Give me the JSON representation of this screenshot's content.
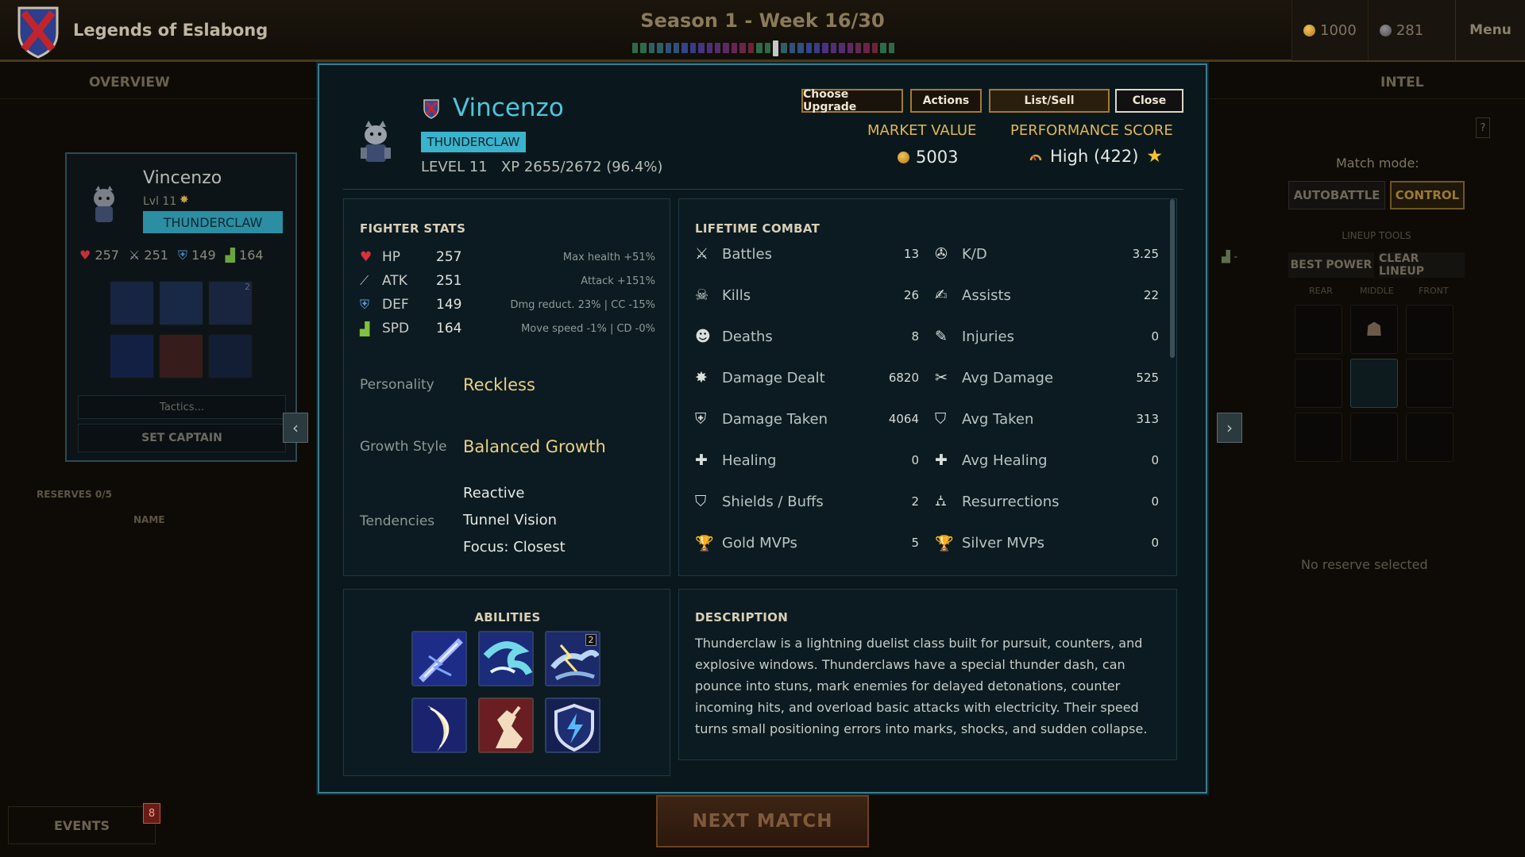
{
  "header": {
    "game_title": "Legends of Eslabong",
    "season": "Season 1 - Week 16/30",
    "week_current": 16,
    "week_total": 30,
    "gold": "1000",
    "gems": "281",
    "menu_label": "Menu"
  },
  "tabs": {
    "overview": "OVERVIEW",
    "intel": "INTEL"
  },
  "background_card": {
    "name": "Vincenzo",
    "level": "Lvl 11",
    "class": "THUNDERCLAW",
    "hp": "257",
    "atk": "251",
    "def": "149",
    "spd": "164",
    "ability_badge": "2",
    "tactics_label": "Tactics...",
    "set_captain_label": "SET CAPTAIN",
    "reserves_label": "RESERVES",
    "reserves_count": "0/5",
    "name_header": "NAME"
  },
  "right_panel": {
    "help": "?",
    "match_mode_label": "Match mode:",
    "autobattle": "AUTOBATTLE",
    "control": "CONTROL",
    "lineup_tools": "LINEUP TOOLS",
    "best_power": "BEST POWER",
    "clear_lineup": "CLEAR LINEUP",
    "rear": "REAR",
    "middle": "MIDDLE",
    "front": "FRONT",
    "no_reserve": "No reserve selected",
    "spd_dash": "-"
  },
  "footer": {
    "events_label": "EVENTS",
    "events_badge": "8",
    "next_match": "NEXT MATCH"
  },
  "fighter": {
    "name": "Vincenzo",
    "class": "THUNDERCLAW",
    "level_label": "LEVEL 11",
    "xp_label": "XP 2655/2672 (96.4%)",
    "market_value_label": "MARKET VALUE",
    "market_value": "5003",
    "performance_label": "PERFORMANCE SCORE",
    "performance_value": "High (422)"
  },
  "actions": {
    "choose_upgrade": "Choose Upgrade",
    "actions": "Actions",
    "list_sell": "List/Sell",
    "close": "Close"
  },
  "stats": {
    "title": "FIGHTER STATS",
    "rows": [
      {
        "label": "HP",
        "value": "257",
        "note": "Max health +51%",
        "icon": "heart-icon",
        "color": "#d8323a"
      },
      {
        "label": "ATK",
        "value": "251",
        "note": "Attack +151%",
        "icon": "sword-icon",
        "color": "#b9b9d6"
      },
      {
        "label": "DEF",
        "value": "149",
        "note": "Dmg reduct. 23% | CC -15%",
        "icon": "shield-icon",
        "color": "#5aa3e0"
      },
      {
        "label": "SPD",
        "value": "164",
        "note": "Move speed -1% | CD -0%",
        "icon": "boot-icon",
        "color": "#7fc240"
      }
    ],
    "personality_label": "Personality",
    "personality": "Reckless",
    "growth_label": "Growth Style",
    "growth": "Balanced Growth",
    "tendencies_label": "Tendencies",
    "tendencies": [
      "Reactive",
      "Tunnel Vision",
      "Focus: Closest"
    ]
  },
  "combat": {
    "title": "LIFETIME COMBAT",
    "left": [
      {
        "label": "Battles",
        "value": "13",
        "icon": "crossed-swords-icon"
      },
      {
        "label": "Kills",
        "value": "26",
        "icon": "skull-icon"
      },
      {
        "label": "Deaths",
        "value": "8",
        "icon": "dead-skull-icon"
      },
      {
        "label": "Damage Dealt",
        "value": "6820",
        "icon": "burst-icon"
      },
      {
        "label": "Damage Taken",
        "value": "4064",
        "icon": "cracked-shield-icon"
      },
      {
        "label": "Healing",
        "value": "0",
        "icon": "plus-icon"
      },
      {
        "label": "Shields / Buffs",
        "value": "2",
        "icon": "shield-icon"
      },
      {
        "label": "Gold MVPs",
        "value": "5",
        "icon": "gold-trophy-icon"
      }
    ],
    "right": [
      {
        "label": "K/D",
        "value": "3.25",
        "icon": "target-icon"
      },
      {
        "label": "Assists",
        "value": "22",
        "icon": "handshake-icon"
      },
      {
        "label": "Injuries",
        "value": "0",
        "icon": "bandage-icon"
      },
      {
        "label": "Avg Damage",
        "value": "525",
        "icon": "crossed-blades-icon"
      },
      {
        "label": "Avg Taken",
        "value": "313",
        "icon": "shield-icon"
      },
      {
        "label": "Avg Healing",
        "value": "0",
        "icon": "plus-icon"
      },
      {
        "label": "Resurrections",
        "value": "0",
        "icon": "tombstone-icon"
      },
      {
        "label": "Silver MVPs",
        "value": "0",
        "icon": "silver-trophy-icon"
      }
    ]
  },
  "abilities": {
    "title": "ABILITIES",
    "badge": "2",
    "items": [
      "thunder-strike-icon",
      "storm-wave-icon",
      "lightning-wolf-icon",
      "crescent-slash-icon",
      "dash-figure-icon",
      "lightning-shield-icon"
    ]
  },
  "description": {
    "title": "DESCRIPTION",
    "text": "Thunderclaw is a lightning duelist class built for pursuit, counters, and explosive windows. Thunderclaws have a special thunder dash, can pounce into stuns, mark enemies for delayed detonations, counter incoming hits, and overload basic attacks with electricity. Their speed turns small positioning errors into marks, shocks, and sudden collapse."
  }
}
